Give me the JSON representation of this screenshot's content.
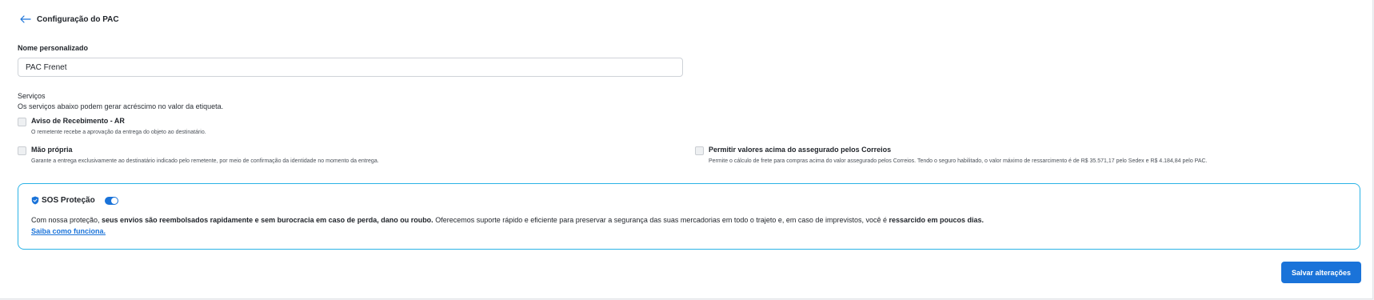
{
  "header": {
    "title": "Configuração do PAC",
    "back_icon": "arrow-left-icon"
  },
  "name_field": {
    "label": "Nome personalizado",
    "value": "PAC Frenet"
  },
  "services": {
    "title": "Serviços",
    "subtitle": "Os serviços abaixo podem gerar acréscimo no valor da etiqueta.",
    "options": [
      {
        "title": "Aviso de Recebimento - AR",
        "description": "O remetente recebe a aprovação da entrega do objeto ao destinatário.",
        "checked": false
      },
      {
        "title": "Mão própria",
        "description": "Garante a entrega exclusivamente ao destinatário indicado pelo remetente, por meio de confirmação da identidade no momento da entrega.",
        "checked": false
      },
      {
        "title": "Permitir valores acima do assegurado pelos Correios",
        "description": "Permite o cálculo de frete para compras acima do valor assegurado pelos Correios. Tendo o seguro habilitado, o valor máximo de ressarcimento é de R$ 35.571,17 pelo Sedex e R$ 4.184,84 pelo PAC.",
        "checked": false
      }
    ]
  },
  "sos": {
    "title": "SOS Proteção",
    "enabled": true,
    "text_1": "Com nossa proteção, ",
    "text_bold_1": "seus envios são reembolsados rapidamente e sem burocracia em caso de perda, dano ou roubo.",
    "text_2": " Oferecemos suporte rápido e eficiente para preservar a segurança das suas mercadorias em todo o trajeto e, em caso de imprevistos, você é ",
    "text_bold_2": "ressarcido em poucos dias.",
    "link": "Saiba como funciona.",
    "accent_color": "#1a73d9",
    "border_color": "#2bb3e6"
  },
  "actions": {
    "save_label": "Salvar alterações"
  }
}
